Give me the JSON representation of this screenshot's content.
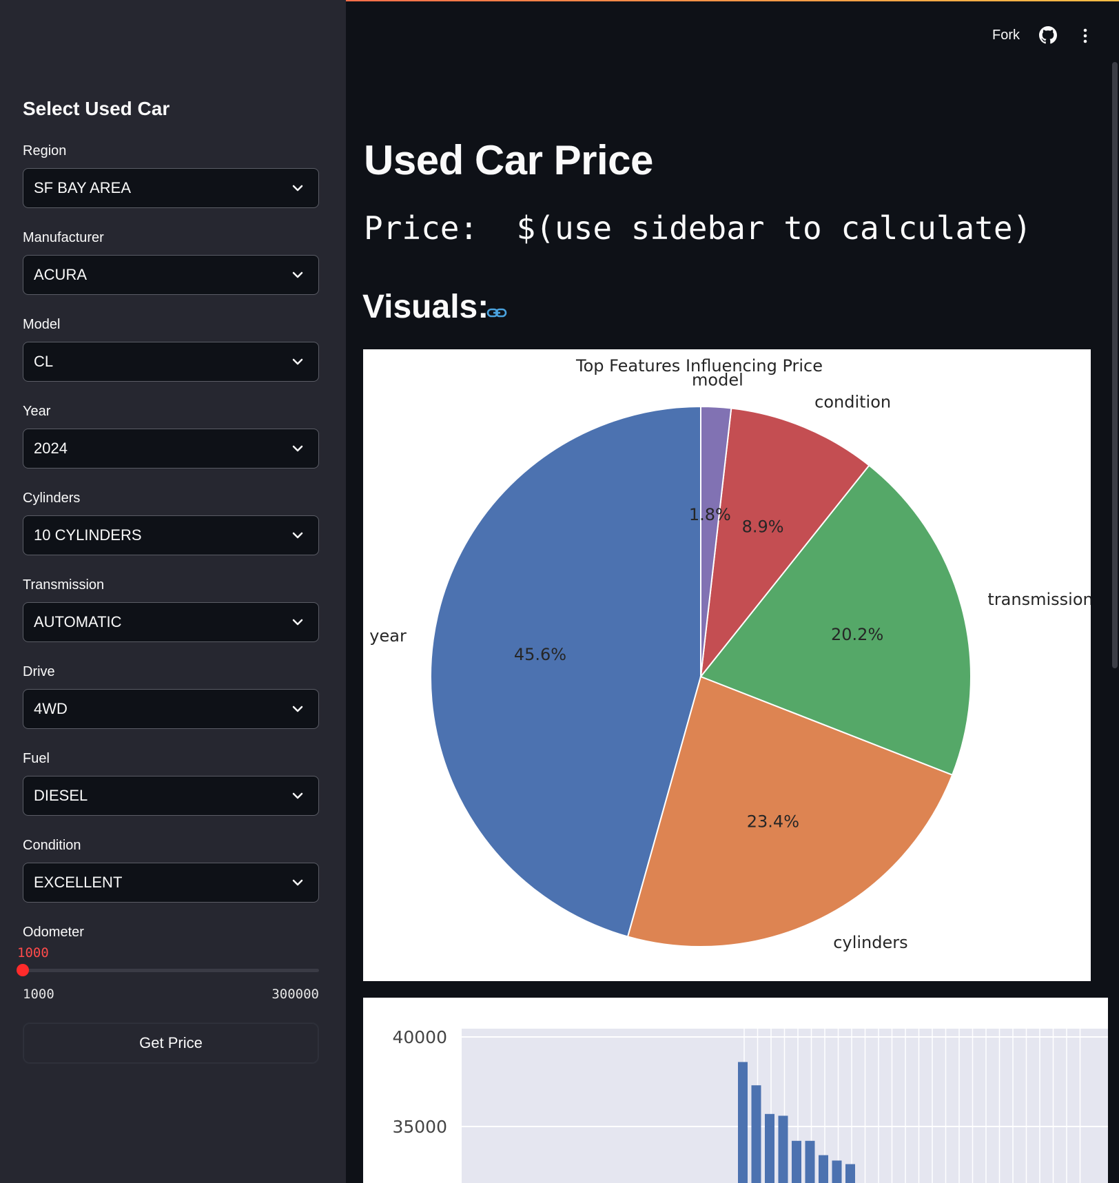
{
  "sidebar": {
    "title": "Select Used Car",
    "fields": [
      {
        "label": "Region",
        "value": "SF BAY AREA"
      },
      {
        "label": "Manufacturer",
        "value": "ACURA"
      },
      {
        "label": "Model",
        "value": "CL"
      },
      {
        "label": "Year",
        "value": "2024"
      },
      {
        "label": "Cylinders",
        "value": "10 CYLINDERS"
      },
      {
        "label": "Transmission",
        "value": "AUTOMATIC"
      },
      {
        "label": "Drive",
        "value": "4WD"
      },
      {
        "label": "Fuel",
        "value": "DIESEL"
      },
      {
        "label": "Condition",
        "value": "EXCELLENT"
      }
    ],
    "odometer": {
      "label": "Odometer",
      "value": "1000",
      "min": "1000",
      "max": "300000",
      "position": 0
    },
    "button_label": "Get Price"
  },
  "header": {
    "fork_label": "Fork",
    "icons": [
      "github-icon",
      "kebab-menu-icon"
    ]
  },
  "main": {
    "title": "Used Car Price",
    "price_text": "Price:  $(use sidebar to calculate)",
    "visuals_heading": "Visuals:"
  },
  "colors": {
    "accent": "#ff4b4b",
    "link": "#4aa3df",
    "pie": [
      "#4c72b0",
      "#dd8452",
      "#55a868",
      "#c44e52",
      "#8172b3"
    ]
  },
  "chart_data": [
    {
      "type": "pie",
      "title": "Top Features Influencing Price",
      "categories": [
        "year",
        "cylinders",
        "transmission",
        "condition",
        "model"
      ],
      "values": [
        45.6,
        23.4,
        20.2,
        8.9,
        1.8
      ],
      "value_labels": [
        "45.6%",
        "23.4%",
        "20.2%",
        "8.9%",
        "1.8%"
      ],
      "start_angle_deg": 90,
      "direction": "counterclockwise"
    },
    {
      "type": "bar",
      "ylim": [
        30000,
        41500
      ],
      "yticks": [
        "40000",
        "35000"
      ],
      "grid": true,
      "values": [
        38600,
        37300,
        35700,
        35600,
        34200,
        34200,
        33400,
        33100,
        32900
      ],
      "categories": [
        "",
        "",
        "",
        "",
        "",
        "",
        "",
        "",
        ""
      ]
    }
  ]
}
